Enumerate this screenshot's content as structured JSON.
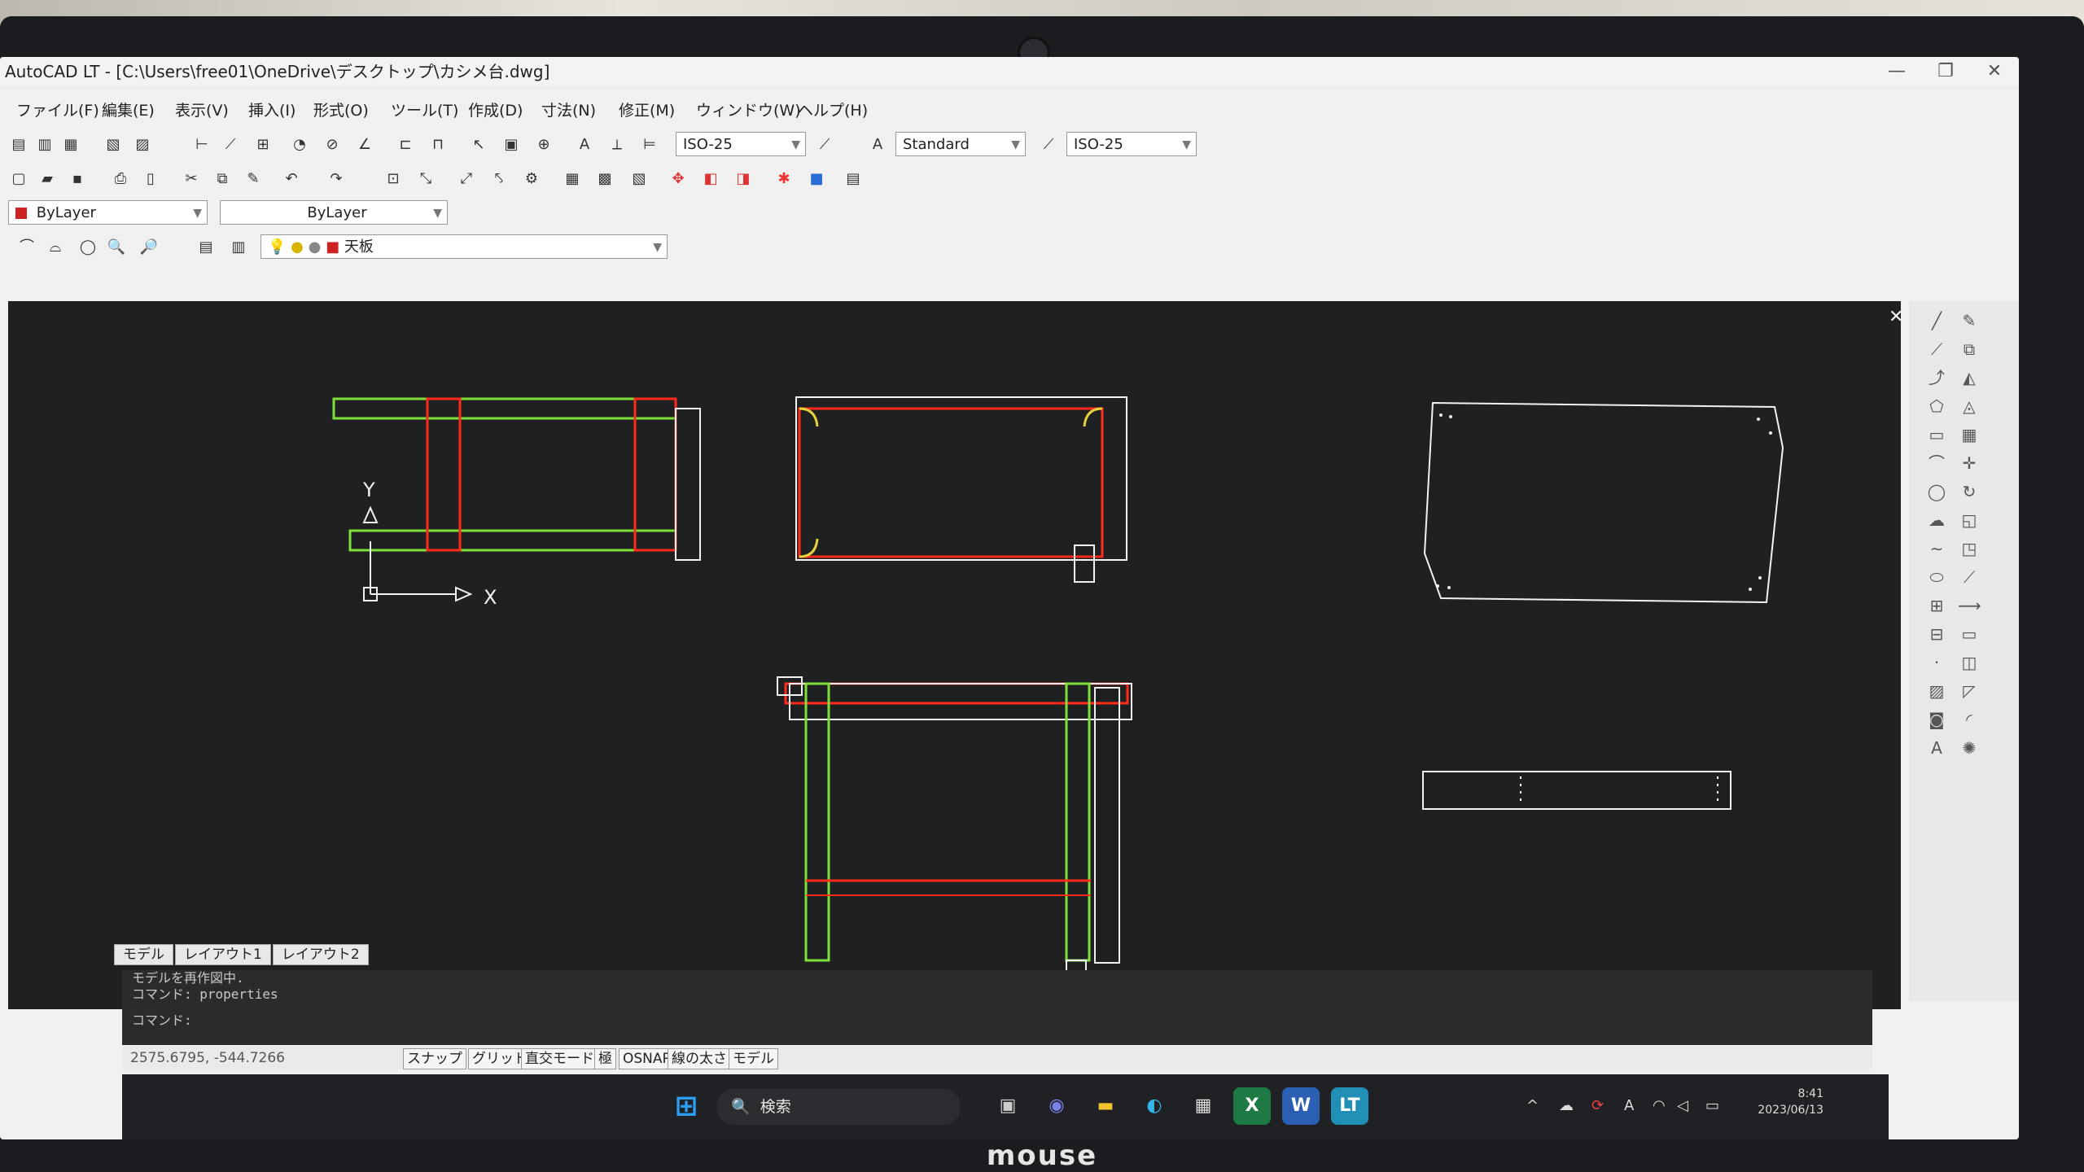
{
  "window": {
    "title": "AutoCAD LT - [C:\\Users\\free01\\OneDrive\\デスクトップ\\カシメ台.dwg]"
  },
  "menu": [
    "ファイル(F)",
    "編集(E)",
    "表示(V)",
    "挿入(I)",
    "形式(O)",
    "ツール(T)",
    "作成(D)",
    "寸法(N)",
    "修正(M)",
    "ウィンドウ(W)",
    "ヘルプ(H)"
  ],
  "toolbar": {
    "dimstyle": "ISO-25",
    "textstyle": "Standard",
    "dimstyle2": "ISO-25",
    "color": "ByLayer",
    "linetype": "ByLayer",
    "layer": "天板"
  },
  "drawing": {
    "axis_x": "X",
    "axis_y": "Y",
    "colors": {
      "green": "#7fe03a",
      "red": "#ff2a1a",
      "white": "#f2f2f2",
      "yellow": "#e8d23a"
    }
  },
  "tabs": [
    "モデル",
    "レイアウト1",
    "レイアウト2"
  ],
  "command_line": [
    "モデルを再作図中.",
    "コマンド: properties",
    "コマンド:"
  ],
  "status": {
    "coords": "2575.6795, -544.7266",
    "buttons": [
      "スナップ",
      "グリッド",
      "直交モード",
      "極",
      "OSNAP",
      "線の太さ",
      "モデル"
    ]
  },
  "taskbar": {
    "search": "検索",
    "time": "8:41",
    "date": "2023/06/13"
  },
  "laptop_brand": "mouse"
}
